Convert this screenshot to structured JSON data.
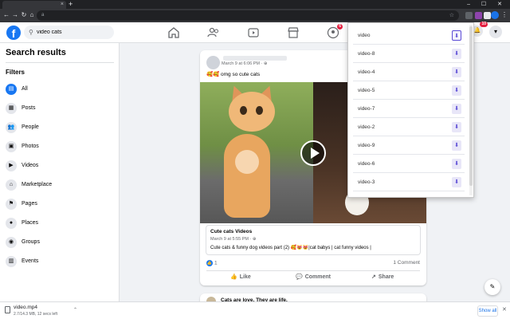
{
  "browser": {
    "address_text": "a",
    "new_tab_label": "+",
    "close_tab_label": "×",
    "window_controls": "– ☐ ✕",
    "colors": {
      "chrome_dark": "#202124",
      "toolbar": "#35363a"
    }
  },
  "fb": {
    "logo_letter": "f",
    "search_value": "video cats",
    "notification_badge": "10",
    "groups_badge": "6",
    "colors": {
      "brand": "#1877f2",
      "badge": "#e41e3f"
    },
    "nav_icons": [
      "home-icon",
      "friends-icon",
      "watch-icon",
      "marketplace-icon",
      "groups-icon"
    ]
  },
  "sidebar": {
    "title": "Search results",
    "filters_label": "Filters",
    "items": [
      {
        "label": "All",
        "icon": "all-icon",
        "glyph": "▤"
      },
      {
        "label": "Posts",
        "icon": "posts-icon",
        "glyph": "▦"
      },
      {
        "label": "People",
        "icon": "people-icon",
        "glyph": "👥"
      },
      {
        "label": "Photos",
        "icon": "photos-icon",
        "glyph": "▣"
      },
      {
        "label": "Videos",
        "icon": "videos-icon",
        "glyph": "▶"
      },
      {
        "label": "Marketplace",
        "icon": "marketplace-icon",
        "glyph": "⌂"
      },
      {
        "label": "Pages",
        "icon": "pages-icon",
        "glyph": "⚑"
      },
      {
        "label": "Places",
        "icon": "places-icon",
        "glyph": "●"
      },
      {
        "label": "Groups",
        "icon": "groups-icon",
        "glyph": "◉"
      },
      {
        "label": "Events",
        "icon": "events-icon",
        "glyph": "▥"
      }
    ]
  },
  "post": {
    "timestamp": "March 9 at 6:06 PM · ⊕",
    "text": "🥰🥰 omg so cute cats",
    "shared": {
      "title": "Cute cats Videos",
      "meta": "March 9 at 5:55 PM · ⊕",
      "text": "Cute cats & funny dog videos part (2) 🥰😻😻|cat babys | cat funny videos |"
    },
    "like_count": "1",
    "comment_count": "1 Comment",
    "actions": {
      "like": "Like",
      "comment": "Comment",
      "share": "Share"
    }
  },
  "post2": {
    "title": "Cats are love. They are life."
  },
  "download_panel": {
    "items": [
      "video",
      "video-8",
      "video-4",
      "video-5",
      "video-7",
      "video-2",
      "video-9",
      "video-6",
      "video-3"
    ],
    "download_glyph": "⬇"
  },
  "download_shelf": {
    "file_name": "video.mp4",
    "status": "2.7/14.3 MB, 12 secs left",
    "show_all": "Show all",
    "close": "✕"
  }
}
